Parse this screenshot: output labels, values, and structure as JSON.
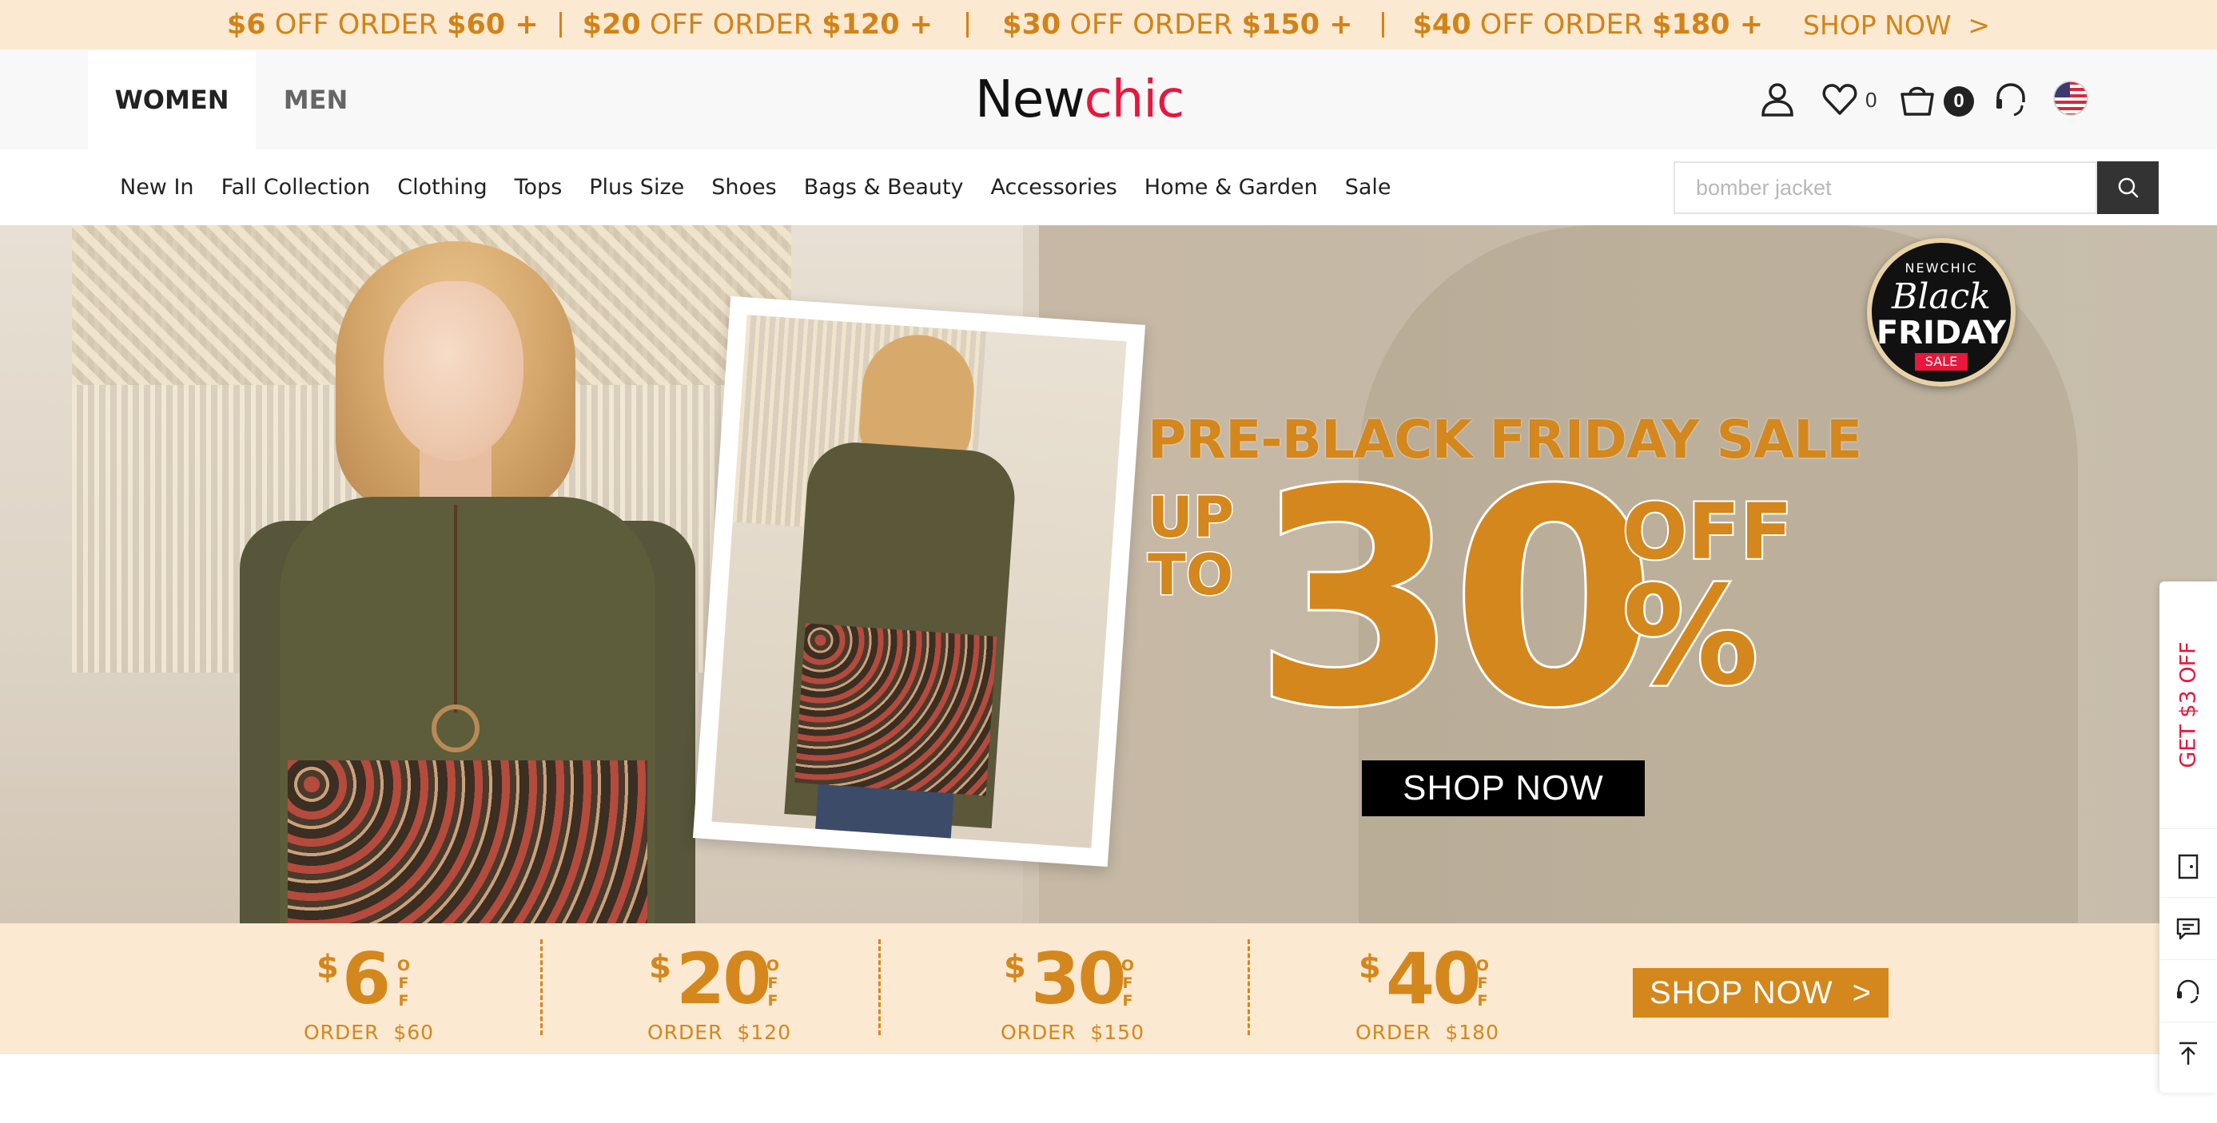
{
  "promo_bar": {
    "items": [
      {
        "amount": "$6",
        "middle": " OFF ORDER ",
        "threshold": "$60 +"
      },
      {
        "amount": "$20",
        "middle": " OFF ORDER ",
        "threshold": "$120 +"
      },
      {
        "amount": "$30",
        "middle": " OFF ORDER ",
        "threshold": "$150 +"
      },
      {
        "amount": "$40",
        "middle": " OFF ORDER ",
        "threshold": "$180 +"
      }
    ],
    "shop_now": "SHOP NOW  >",
    "color": "#d28318",
    "background": "#fbe9d1"
  },
  "header": {
    "tabs": [
      {
        "label": "WOMEN",
        "active": true
      },
      {
        "label": "MEN",
        "active": false
      }
    ],
    "logo": {
      "part1": "New",
      "part2": "chic"
    },
    "wishlist_count": "0",
    "cart_count": "0",
    "icons": [
      "account-icon",
      "heart-icon",
      "cart-icon",
      "customer-service-icon",
      "us-flag-icon"
    ]
  },
  "nav": {
    "items": [
      "New In",
      "Fall Collection",
      "Clothing",
      "Tops",
      "Plus Size",
      "Shoes",
      "Bags & Beauty",
      "Accessories",
      "Home & Garden",
      "Sale"
    ],
    "search_placeholder": "bomber jacket"
  },
  "hero": {
    "badge": {
      "brand": "NEWCHIC",
      "line1": "Black",
      "line2": "FRIDAY",
      "line3": "SALE"
    },
    "title": "PRE-BLACK FRIDAY SALE",
    "up_to_line1": "UP",
    "up_to_line2": "TO",
    "number": "30",
    "off": "OFF",
    "percent": "%",
    "button": "SHOP NOW",
    "accent": "#d4871c"
  },
  "coupons": {
    "items": [
      {
        "currency": "$",
        "amount": "6",
        "off_letters": [
          "O",
          "F",
          "F"
        ],
        "order": "ORDER  $60"
      },
      {
        "currency": "$",
        "amount": "20",
        "off_letters": [
          "O",
          "F",
          "F"
        ],
        "order": "ORDER  $120"
      },
      {
        "currency": "$",
        "amount": "30",
        "off_letters": [
          "O",
          "F",
          "F"
        ],
        "order": "ORDER  $150"
      },
      {
        "currency": "$",
        "amount": "40",
        "off_letters": [
          "O",
          "F",
          "F"
        ],
        "order": "ORDER  $180"
      }
    ],
    "shop_now": "SHOP NOW  >"
  },
  "sidebar": {
    "promo": "GET $3 OFF",
    "icons": [
      "coupon-icon",
      "feedback-icon",
      "support-icon",
      "back-to-top-icon"
    ],
    "promo_color": "#e8173b"
  }
}
